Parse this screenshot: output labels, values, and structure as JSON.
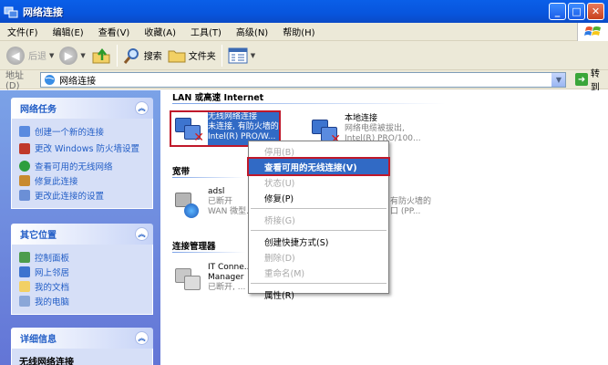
{
  "window": {
    "title": "网络连接"
  },
  "window_buttons": {
    "minimize": "_",
    "maximize": "□",
    "close": "✕"
  },
  "menu": [
    "文件(F)",
    "编辑(E)",
    "查看(V)",
    "收藏(A)",
    "工具(T)",
    "高级(N)",
    "帮助(H)"
  ],
  "toolbar": {
    "back": "后退",
    "search": "搜索",
    "folders": "文件夹"
  },
  "address": {
    "label": "地址(D)",
    "value": "网络连接",
    "go": "转到"
  },
  "sidebar": {
    "network_tasks": {
      "title": "网络任务",
      "items": [
        "创建一个新的连接",
        "更改 Windows 防火墙设置",
        "查看可用的无线网络",
        "修复此连接",
        "更改此连接的设置"
      ]
    },
    "other_places": {
      "title": "其它位置",
      "items": [
        "控制面板",
        "网上邻居",
        "我的文档",
        "我的电脑"
      ]
    },
    "details": {
      "title": "详细信息",
      "item": "无线网络连接"
    }
  },
  "groups": {
    "lan": "LAN 或高速 Internet",
    "broadband": "宽带",
    "conn_manager": "连接管理器"
  },
  "connections": {
    "wireless": {
      "name": "无线网络连接",
      "status": "未连接, 有防火墙的",
      "device": "Intel(R) PRO/W..."
    },
    "local": {
      "name": "本地连接",
      "status": "网络电缆被拔出,",
      "device": "Intel(R) PRO/100..."
    },
    "adsl": {
      "name": "adsl",
      "status": "已断开",
      "device": "WAN 微型..."
    },
    "adsl_right": {
      "status": "有防火墙的",
      "device": "口 (PP..."
    },
    "itconn": {
      "name": "IT Conne...",
      "type": "Manager",
      "status": "已断开, ..."
    }
  },
  "context_menu": {
    "disable": "停用(B)",
    "view_wireless": "查看可用的无线连接(V)",
    "status": "状态(U)",
    "repair": "修复(P)",
    "bridge": "桥接(G)",
    "shortcut": "创建快捷方式(S)",
    "delete": "删除(D)",
    "rename": "重命名(M)",
    "properties": "属性(R)"
  },
  "colors": {
    "title_bar": "#0855dd",
    "sidebar": "#6f8ee0",
    "highlight": "#316ac5",
    "annotation": "#c0182a"
  }
}
